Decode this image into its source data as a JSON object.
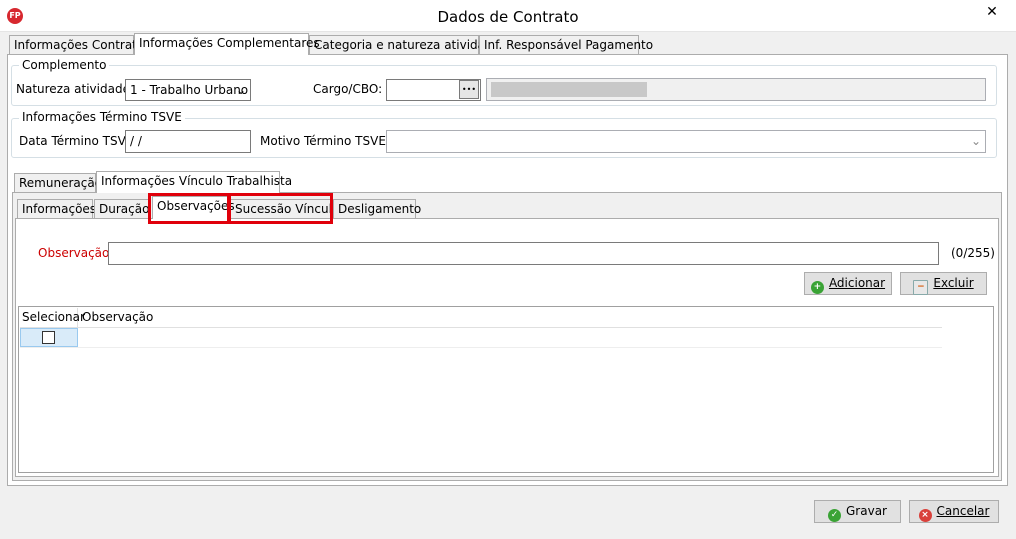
{
  "window": {
    "title": "Dados de Contrato",
    "app_icon_text": "FP",
    "close_glyph": "✕"
  },
  "main_tabs": [
    {
      "label": "Informações Contrato"
    },
    {
      "label": "Informações Complementares"
    },
    {
      "label": "Categoria e natureza atividade"
    },
    {
      "label": "Inf. Responsável Pagamento"
    }
  ],
  "complemento": {
    "legend": "Complemento",
    "natureza_label": "Natureza atividade:",
    "natureza_value": "1 - Trabalho Urbano",
    "cargo_label": "Cargo/CBO:",
    "cargo_value": "",
    "ellipsis": "•••",
    "cargo_description": ""
  },
  "termino": {
    "legend": "Informações Término TSVE",
    "data_label": "Data Término TSVE:",
    "data_value": " /  /",
    "motivo_label": "Motivo Término TSVE:",
    "motivo_value": ""
  },
  "sub_tabs": [
    {
      "label": "Remuneração"
    },
    {
      "label": "Informações Vínculo Trabalhista"
    }
  ],
  "inner_tabs": [
    {
      "label": "Informações"
    },
    {
      "label": "Duração"
    },
    {
      "label": "Observações"
    },
    {
      "label": "Sucessão Vínculo"
    },
    {
      "label": "Desligamento"
    }
  ],
  "observacao": {
    "label": "Observação:",
    "value": "",
    "counter": "(0/255)",
    "label_color": "#cc0000"
  },
  "buttons": {
    "adicionar": "Adicionar",
    "excluir": "Excluir",
    "gravar": "Gravar",
    "cancelar": "Cancelar"
  },
  "grid": {
    "columns": [
      "Selecionar",
      "Observação"
    ],
    "rows": [
      {
        "selecionar": false,
        "observacao": ""
      }
    ]
  },
  "colors": {
    "highlight": "#e0000b",
    "add_icon": "#3aa335",
    "cancel_icon": "#d9403a",
    "ok_icon": "#3aa335"
  }
}
